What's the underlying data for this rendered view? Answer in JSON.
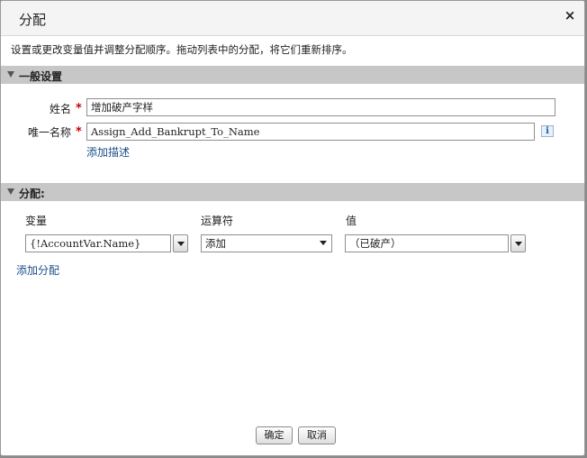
{
  "dialog": {
    "title": "分配",
    "close_glyph": "×",
    "description": "设置或更改变量值并调整分配顺序。拖动列表中的分配，将它们重新排序。"
  },
  "general": {
    "header": "一般设置",
    "name_label": "姓名",
    "name_value": "增加破产字样",
    "unique_label": "唯一名称",
    "unique_value": "Assign_Add_Bankrupt_To_Name",
    "info_glyph": "i",
    "add_description": "添加描述",
    "required_mark": "*"
  },
  "assignments": {
    "header": "分配:",
    "columns": {
      "variable": "变量",
      "operator": "运算符",
      "value": "值"
    },
    "rows": [
      {
        "variable": "{!AccountVar.Name}",
        "operator": "添加",
        "value": "（已破产）"
      }
    ],
    "add_assignment": "添加分配"
  },
  "footer": {
    "ok": "确定",
    "cancel": "取消"
  }
}
